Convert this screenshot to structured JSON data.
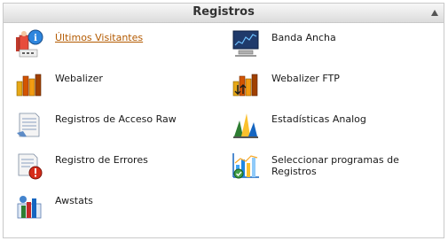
{
  "panel": {
    "title": "Registros",
    "items_left": [
      {
        "label": "Últimos Visitantes",
        "icon": "latest-visitors-icon",
        "link": true
      },
      {
        "label": "Webalizer",
        "icon": "webalizer-icon"
      },
      {
        "label": "Registros de Acceso Raw",
        "icon": "raw-access-logs-icon"
      },
      {
        "label": "Registro de Errores",
        "icon": "error-log-icon"
      },
      {
        "label": "Awstats",
        "icon": "awstats-icon"
      }
    ],
    "items_right": [
      {
        "label": "Banda Ancha",
        "icon": "bandwidth-icon"
      },
      {
        "label": "Webalizer FTP",
        "icon": "webalizer-ftp-icon"
      },
      {
        "label": "Estadísticas Analog",
        "icon": "analog-stats-icon"
      },
      {
        "label": "Seleccionar programas de Registros",
        "icon": "choose-log-programs-icon"
      }
    ]
  },
  "colors": {
    "link": "#b35a00",
    "text": "#1a1a1a",
    "header_bg": "#dcdcdc",
    "border": "#c9c9c9"
  }
}
